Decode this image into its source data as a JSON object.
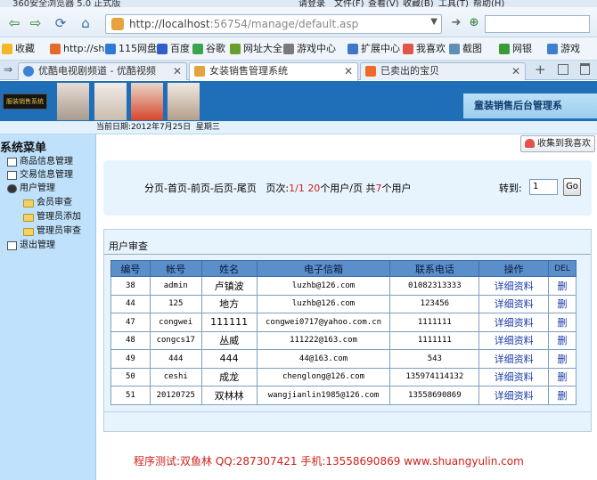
{
  "browser": {
    "title": "360安全浏览器 5.0 正式版",
    "menu": [
      "请登录",
      "文件(F)",
      "查看(V)",
      "收藏(B)",
      "工具(T)",
      "帮助(H)"
    ],
    "url_host": "http://localhost",
    "url_rest": ":56754/manage/default.asp",
    "bookmarks": [
      "收藏",
      "http://sh",
      "115网盘",
      "百度",
      "谷歌",
      "网址大全",
      "游戏中心",
      "扩展中心",
      "我喜欢",
      "截图",
      "网银",
      "游戏"
    ],
    "tabs": [
      "优酷电视剧频道 - 优酷视频",
      "女装销售管理系统",
      "已卖出的宝贝"
    ],
    "active_tab": 1
  },
  "header": {
    "logo_text": "服装销售系统",
    "system_title": "童装销售后台管理系",
    "date_label": "当前日期:",
    "date_value": "2012年7月25日",
    "weekday": "星期三"
  },
  "sidebar": {
    "title": "系统菜单",
    "items": [
      {
        "label": "商品信息管理",
        "level": 1
      },
      {
        "label": "交易信息管理",
        "level": 1
      },
      {
        "label": "用户管理",
        "level": 1
      },
      {
        "label": "会员审查",
        "level": 2
      },
      {
        "label": "管理员添加",
        "level": 2
      },
      {
        "label": "管理员审查",
        "level": 2
      },
      {
        "label": "退出管理",
        "level": 1
      }
    ]
  },
  "fav_button": "收集到我喜欢",
  "pager": {
    "nav": "分页-首页-前页-后页-尾页",
    "page_label": "页次:",
    "page_value": "1/1",
    "per_page": "20",
    "per_page_unit": "个用户/页",
    "total_label": "共",
    "total": "7",
    "total_unit": "个用户",
    "goto_label": "转到:",
    "goto_value": "1",
    "go_button": "Go"
  },
  "panel_title": "用户审查",
  "table": {
    "headers": [
      "编号",
      "帐号",
      "姓名",
      "电子信箱",
      "联系电话",
      "操作",
      "DEL"
    ],
    "rows": [
      [
        "38",
        "admin",
        "卢镇波",
        "luzhb@126.com",
        "01082313333",
        "详细资料",
        "删"
      ],
      [
        "44",
        "125",
        "地方",
        "luzhb@126.com",
        "123456",
        "详细资料",
        "删"
      ],
      [
        "47",
        "congwei",
        "111111",
        "congwei0717@yahoo.com.cn",
        "1111111",
        "详细资料",
        "删"
      ],
      [
        "48",
        "congcs17",
        "丛威",
        "111222@163.com",
        "1111111",
        "详细资料",
        "删"
      ],
      [
        "49",
        "444",
        "444",
        "44@163.com",
        "543",
        "详细资料",
        "删"
      ],
      [
        "50",
        "ceshi",
        "成龙",
        "chenglong@126.com",
        "135974114132",
        "详细资料",
        "删"
      ],
      [
        "51",
        "20120725",
        "双林林",
        "wangjianlin1985@126.com",
        "13558690869",
        "详细资料",
        "删"
      ]
    ]
  },
  "footer": "程序测试:双鱼林 QQ:287307421 手机:13558690869 www.shuangyulin.com",
  "colors": {
    "banner": "#1f6fb8",
    "sidebar": "#bfe1fb",
    "header_row": "#5b8fcc",
    "accent_red": "#d0201a"
  }
}
